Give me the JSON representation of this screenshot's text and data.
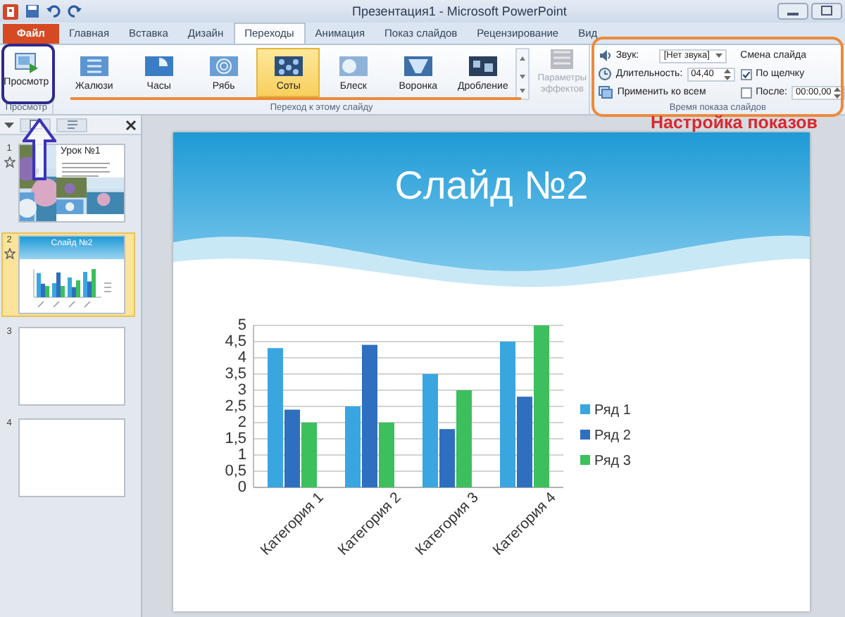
{
  "window": {
    "title": "Презентация1 - Microsoft PowerPoint"
  },
  "tabs": [
    {
      "label": "Файл",
      "kind": "file",
      "selected": false
    },
    {
      "label": "Главная",
      "kind": "tab",
      "selected": false
    },
    {
      "label": "Вставка",
      "kind": "tab",
      "selected": false
    },
    {
      "label": "Дизайн",
      "kind": "tab",
      "selected": false
    },
    {
      "label": "Переходы",
      "kind": "tab",
      "selected": true
    },
    {
      "label": "Анимация",
      "kind": "tab",
      "selected": false
    },
    {
      "label": "Показ слайдов",
      "kind": "tab",
      "selected": false
    },
    {
      "label": "Рецензирование",
      "kind": "tab",
      "selected": false
    },
    {
      "label": "Вид",
      "kind": "tab",
      "selected": false
    }
  ],
  "ribbon": {
    "preview_group": {
      "button": "Просмотр",
      "label": "Просмотр"
    },
    "transitions_group": {
      "label": "Переход к этому слайду",
      "items": [
        {
          "label": "Жалюзи",
          "selected": false
        },
        {
          "label": "Часы",
          "selected": false
        },
        {
          "label": "Рябь",
          "selected": false
        },
        {
          "label": "Соты",
          "selected": true
        },
        {
          "label": "Блеск",
          "selected": false
        },
        {
          "label": "Воронка",
          "selected": false
        },
        {
          "label": "Дробление",
          "selected": false
        }
      ],
      "effect_options": {
        "label": "Параметры эффектов",
        "disabled": true
      }
    },
    "timing_group": {
      "label": "Время показа слайдов",
      "sound_label": "Звук:",
      "sound_value": "[Нет звука]",
      "duration_label": "Длительность:",
      "duration_value": "04,40",
      "apply_all": "Применить ко всем",
      "advance_title": "Смена слайда",
      "on_click": {
        "label": "По щелчку",
        "checked": true
      },
      "after": {
        "label": "После:",
        "checked": false,
        "value": "00:00,00"
      }
    }
  },
  "slides_pane": {
    "thumbnails": [
      {
        "number": "1",
        "kind": "photos",
        "title": "Урок №1",
        "has_transition": true,
        "selected": false
      },
      {
        "number": "2",
        "kind": "chart",
        "title": "Слайд №2",
        "has_transition": true,
        "selected": true
      },
      {
        "number": "3",
        "kind": "blank",
        "has_transition": false,
        "selected": false
      },
      {
        "number": "4",
        "kind": "blank",
        "has_transition": false,
        "selected": false
      }
    ]
  },
  "annotation": {
    "text": "Настройка показов"
  },
  "slide": {
    "title": "Слайд №2",
    "chart_data": {
      "type": "bar",
      "categories": [
        "Категория 1",
        "Категория 2",
        "Категория 3",
        "Категория 4"
      ],
      "series": [
        {
          "name": "Ряд 1",
          "color": "#3aa6e0",
          "values": [
            4.3,
            2.5,
            3.5,
            4.5
          ]
        },
        {
          "name": "Ряд 2",
          "color": "#2f6fbf",
          "values": [
            2.4,
            4.4,
            1.8,
            2.8
          ]
        },
        {
          "name": "Ряд 3",
          "color": "#3cbf5c",
          "values": [
            2,
            2,
            3,
            5
          ]
        }
      ],
      "ylim": [
        0,
        5
      ],
      "grid": true,
      "legend": "right",
      "yticks": [
        {
          "value": 0,
          "label": "0"
        },
        {
          "value": 0.5,
          "label": "0,5"
        },
        {
          "value": 1,
          "label": "1"
        },
        {
          "value": 1.5,
          "label": "1,5"
        },
        {
          "value": 2,
          "label": "2"
        },
        {
          "value": 2.5,
          "label": "2,5"
        },
        {
          "value": 3,
          "label": "3"
        },
        {
          "value": 3.5,
          "label": "3,5"
        },
        {
          "value": 4,
          "label": "4"
        },
        {
          "value": 4.5,
          "label": "4,5"
        },
        {
          "value": 5,
          "label": "5"
        }
      ]
    }
  }
}
